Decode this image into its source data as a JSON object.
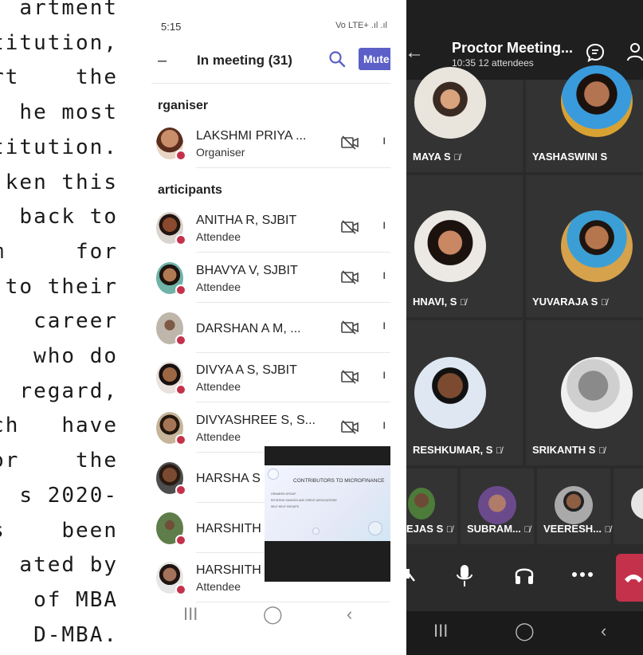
{
  "document": {
    "lines": [
      "artment",
      "titution,",
      "rt    the",
      "he most",
      "titution.",
      "ken this",
      "back to",
      "m     for",
      "to their",
      "career",
      "who do",
      "regard,",
      "ch   have",
      "or    the",
      "s 2020-",
      "s    been",
      "ated by",
      "of MBA",
      "D-MBA."
    ]
  },
  "phone_left": {
    "status": {
      "time": "5:15",
      "right": "Vo LTE+ .ıl .ıl"
    },
    "header": {
      "title": "In meeting (31)",
      "mute_label": "Mute"
    },
    "sections": {
      "organiser": "rganiser",
      "participants": "articipants"
    },
    "organiser": {
      "name": "LAKSHMI PRIYA ...",
      "role": "Organiser"
    },
    "participants": [
      {
        "name": "ANITHA R, SJBIT",
        "role": "Attendee"
      },
      {
        "name": "BHAVYA V, SJBIT",
        "role": "Attendee"
      },
      {
        "name": "DARSHAN  A M, ...",
        "role": ""
      },
      {
        "name": "DIVYA A S, SJBIT",
        "role": "Attendee"
      },
      {
        "name": "DIVYASHREE S, S...",
        "role": "Attendee"
      },
      {
        "name": "HARSHA S",
        "role": ""
      },
      {
        "name": "HARSHITH",
        "role": ""
      },
      {
        "name": "HARSHITH",
        "role": "Attendee"
      }
    ]
  },
  "screen_share": {
    "slide_title": "CONTRIBUTORS TO MICROFINANCE",
    "bullets": [
      "GRAMEEN GROUP",
      "ROTATING SAVINGS AND CREDIT ASSOCIATIONS",
      "SELF HELP GROUPS"
    ]
  },
  "phone_right": {
    "meeting": {
      "title": "Proctor Meeting...",
      "time": "10:35",
      "attendees": "12 attendees"
    },
    "tiles": [
      {
        "label": "MAYA S",
        "muted": true
      },
      {
        "label": "YASHASWINI S",
        "muted": false
      },
      {
        "label": "HNAVI, S",
        "muted": true
      },
      {
        "label": "YUVARAJA S",
        "muted": true
      },
      {
        "label": "RESHKUMAR, S",
        "muted": true
      },
      {
        "label": "SRIKANTH S",
        "muted": true
      }
    ],
    "small_tiles": [
      {
        "label": "EJAS S",
        "muted": true
      },
      {
        "label": "SUBRAM...",
        "muted": true
      },
      {
        "label": "VEERESH...",
        "muted": true
      }
    ],
    "mute_glyph": "🎙̸",
    "controls": [
      "camera-off",
      "microphone",
      "headset",
      "more",
      "end-call"
    ]
  },
  "colors": {
    "teams_purple": "#5b5fc7",
    "end_call": "#c4314b",
    "presence_busy": "#c4314b"
  }
}
